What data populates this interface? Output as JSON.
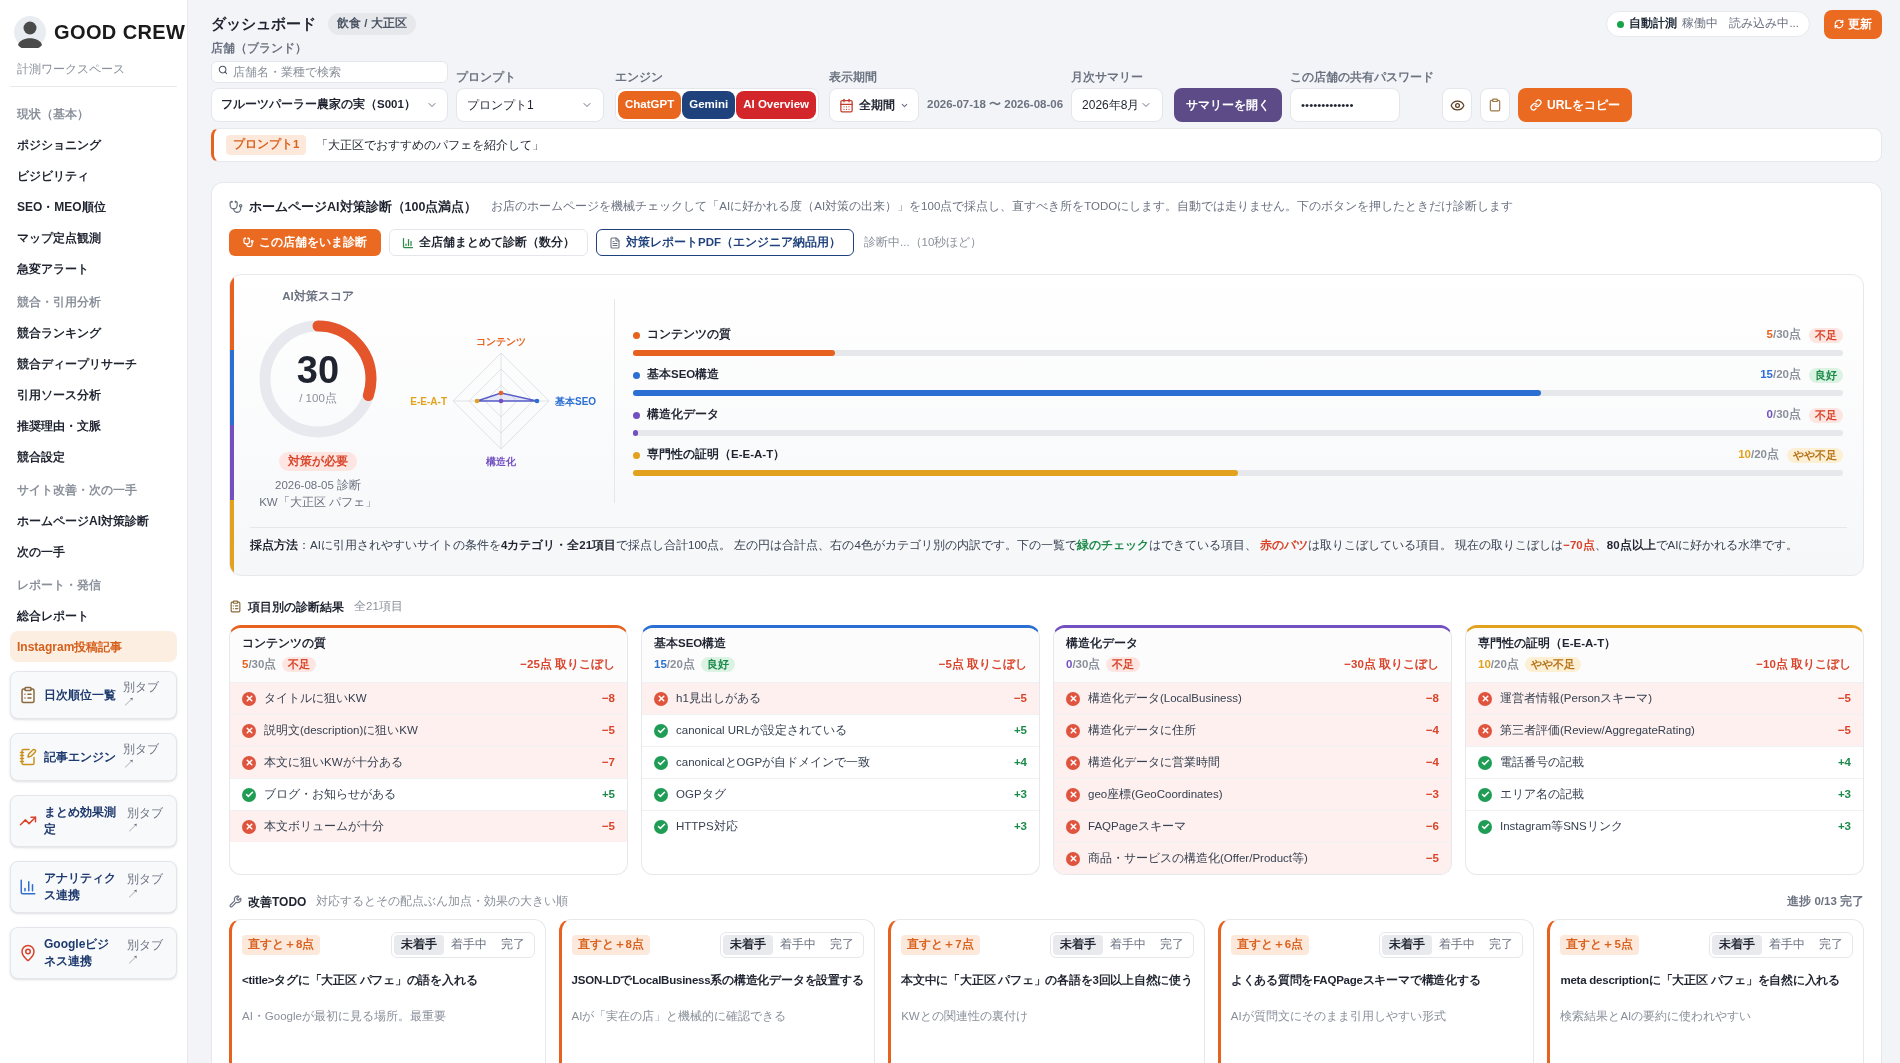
{
  "sidebar": {
    "brand": "GOOD CREW",
    "workspace": "計測ワークスペース",
    "sections": [
      {
        "title": "現状（基本）",
        "items": [
          {
            "label": "ポジショニング",
            "selected": false
          },
          {
            "label": "ビジビリティ",
            "selected": false
          },
          {
            "label": "SEO・MEO順位",
            "selected": false
          },
          {
            "label": "マップ定点観測",
            "selected": false
          },
          {
            "label": "急変アラート",
            "selected": false
          }
        ]
      },
      {
        "title": "競合・引用分析",
        "items": [
          {
            "label": "競合ランキング",
            "selected": false
          },
          {
            "label": "競合ディープリサーチ",
            "selected": false
          },
          {
            "label": "引用ソース分析",
            "selected": false
          },
          {
            "label": "推奨理由・文脈",
            "selected": false
          },
          {
            "label": "競合設定",
            "selected": false
          }
        ]
      },
      {
        "title": "サイト改善・次の一手",
        "items": [
          {
            "label": "ホームページAI対策診断",
            "selected": false
          },
          {
            "label": "次の一手",
            "selected": false
          }
        ]
      },
      {
        "title": "レポート・発信",
        "items": [
          {
            "label": "総合レポート",
            "selected": false
          },
          {
            "label": "Instagram投稿記事",
            "selected": true
          }
        ]
      }
    ],
    "links": [
      {
        "kind": "clipboard",
        "label": "日次順位一覧",
        "note": "別タブ ↗"
      },
      {
        "kind": "memo",
        "label": "記事エンジン",
        "note": "別タブ ↗"
      },
      {
        "kind": "trend",
        "label": "まとめ効果測定",
        "note": "別タブ ↗"
      },
      {
        "kind": "bars",
        "label": "アナリティクス連携",
        "note": "別タブ ↗"
      },
      {
        "kind": "pin",
        "label": "Googleビジネス連携",
        "note": "別タブ ↗"
      }
    ]
  },
  "header": {
    "title": "ダッシュボード",
    "badge": "飲食 / 大正区",
    "auto": {
      "label": "自動計測",
      "state": "稼働中",
      "loading": "読み込み中...",
      "running": true
    },
    "refresh": "更新"
  },
  "filters": {
    "store": {
      "label": "店舗（ブランド）",
      "search_placeholder": "店舗名・業種で検索",
      "value": "フルーツパーラー農家の実（S001）"
    },
    "prompt": {
      "label": "プロンプト",
      "value": "プロンプト1"
    },
    "engine": {
      "label": "エンジン",
      "options": [
        {
          "label": "ChatGPT",
          "color": "#e9661f",
          "selected": true
        },
        {
          "label": "Gemini",
          "color": "#1f417c",
          "selected": true
        },
        {
          "label": "AI Overview",
          "color": "#d2262b",
          "selected": true
        }
      ]
    },
    "period": {
      "label": "表示期間",
      "value": "全期間",
      "range": "2026-07-18 〜 2026-08-06"
    },
    "summary": {
      "label": "月次サマリー",
      "value": "2026年8月",
      "button": "サマリーを開く"
    },
    "password": {
      "label": "この店舗の共有パスワード",
      "value": "•••••••••••••"
    },
    "copy_button": "URLをコピー"
  },
  "prompt_bar": {
    "badge": "プロンプト1",
    "text": "「大正区でおすすめのパフェを紹介して」"
  },
  "diagnosis": {
    "title": "ホームページAI対策診断（100点満点）",
    "description": "お店のホームページを機械チェックして「AIに好かれる度（AI対策の出来）」を100点で採点し、直すべき所をTODOにします。自動では走りません。下のボタンを押したときだけ診断します",
    "actions": [
      {
        "kind": "primary",
        "label": "この店舗をいま診断"
      },
      {
        "kind": "secondary",
        "label": "全店舗まとめて診断（数分）"
      },
      {
        "kind": "outline",
        "label": "対策レポートPDF（エンジニア納品用）"
      }
    ],
    "status": "診断中...（10秒ほど）",
    "score": {
      "label": "AI対策スコア",
      "value": "30",
      "out_of": "/ 100点",
      "level": 0.3,
      "badge": "対策が必要",
      "kind": "bad",
      "date": "2026-08-05 診断",
      "keyword": "KW「大正区 パフェ」"
    },
    "categories": [
      {
        "name": "コンテンツの質",
        "radar_label": "コンテンツ",
        "color": "#e8621f",
        "score": "5",
        "out_of": "/30点",
        "badge": "不足",
        "kind": "bad",
        "level": 0.167
      },
      {
        "name": "基本SEO構造",
        "radar_label": "基本SEO",
        "color": "#2b6fd2",
        "score": "15",
        "out_of": "/20点",
        "badge": "良好",
        "kind": "good",
        "level": 0.75
      },
      {
        "name": "構造化データ",
        "radar_label": "構造化",
        "color": "#7250c0",
        "score": "0",
        "out_of": "/30点",
        "badge": "不足",
        "kind": "bad",
        "level": 0
      },
      {
        "name": "専門性の証明（E-E-A-T）",
        "radar_label": "E-E-A-T",
        "color": "#e3a21e",
        "score": "10",
        "out_of": "/20点",
        "badge": "やや不足",
        "kind": "fair",
        "level": 0.5
      }
    ],
    "note": [
      {
        "text": "採点方法",
        "kind": "bold"
      },
      {
        "text": "：AIに引用されやすいサイトの条件を",
        "kind": "plain"
      },
      {
        "text": "4カテゴリ・全21項目",
        "kind": "bold"
      },
      {
        "text": "で採点し合計100点。 左の円は合計点、右の4色がカテゴリ別の内訳です。下の一覧で",
        "kind": "plain"
      },
      {
        "text": "緑のチェック",
        "kind": "green"
      },
      {
        "text": "はできている項目、 ",
        "kind": "plain"
      },
      {
        "text": "赤のバツ",
        "kind": "red"
      },
      {
        "text": "は取りこぼしている項目。 現在の取りこぼしは",
        "kind": "plain"
      },
      {
        "text": "−70点",
        "kind": "red"
      },
      {
        "text": "、",
        "kind": "plain"
      },
      {
        "text": "80点以上",
        "kind": "bold"
      },
      {
        "text": "でAIに好かれる水準です。",
        "kind": "plain"
      }
    ]
  },
  "item_results": {
    "title": "項目別の診断結果",
    "count": "全21項目",
    "groups": [
      {
        "title": "コンテンツの質",
        "color": "#e8621f",
        "score": "5",
        "out_of": "/30点",
        "badge": "不足",
        "kind": "bad",
        "lost": "−25点 取りこぼし",
        "items": [
          {
            "label": "タイトルに狙いKW",
            "passed": false,
            "points": "−8"
          },
          {
            "label": "説明文(description)に狙いKW",
            "passed": false,
            "points": "−5"
          },
          {
            "label": "本文に狙いKWが十分ある",
            "passed": false,
            "points": "−7"
          },
          {
            "label": "ブログ・お知らせがある",
            "passed": true,
            "points": "+5"
          },
          {
            "label": "本文ボリュームが十分",
            "passed": false,
            "points": "−5"
          }
        ]
      },
      {
        "title": "基本SEO構造",
        "color": "#2b6fd2",
        "score": "15",
        "out_of": "/20点",
        "badge": "良好",
        "kind": "good",
        "lost": "−5点 取りこぼし",
        "items": [
          {
            "label": "h1見出しがある",
            "passed": false,
            "points": "−5"
          },
          {
            "label": "canonical URLが設定されている",
            "passed": true,
            "points": "+5"
          },
          {
            "label": "canonicalとOGPが自ドメインで一致",
            "passed": true,
            "points": "+4"
          },
          {
            "label": "OGPタグ",
            "passed": true,
            "points": "+3"
          },
          {
            "label": "HTTPS対応",
            "passed": true,
            "points": "+3"
          }
        ]
      },
      {
        "title": "構造化データ",
        "color": "#7250c0",
        "score": "0",
        "out_of": "/30点",
        "badge": "不足",
        "kind": "bad",
        "lost": "−30点 取りこぼし",
        "items": [
          {
            "label": "構造化データ(LocalBusiness)",
            "passed": false,
            "points": "−8"
          },
          {
            "label": "構造化データに住所",
            "passed": false,
            "points": "−4"
          },
          {
            "label": "構造化データに営業時間",
            "passed": false,
            "points": "−4"
          },
          {
            "label": "geo座標(GeoCoordinates)",
            "passed": false,
            "points": "−3"
          },
          {
            "label": "FAQPageスキーマ",
            "passed": false,
            "points": "−6"
          },
          {
            "label": "商品・サービスの構造化(Offer/Product等)",
            "passed": false,
            "points": "−5"
          }
        ]
      },
      {
        "title": "専門性の証明（E-E-A-T）",
        "color": "#e3a21e",
        "score": "10",
        "out_of": "/20点",
        "badge": "やや不足",
        "kind": "fair",
        "lost": "−10点 取りこぼし",
        "items": [
          {
            "label": "運営者情報(Personスキーマ)",
            "passed": false,
            "points": "−5"
          },
          {
            "label": "第三者評価(Review/AggregateRating)",
            "passed": false,
            "points": "−5"
          },
          {
            "label": "電話番号の記載",
            "passed": true,
            "points": "+4"
          },
          {
            "label": "エリア名の記載",
            "passed": true,
            "points": "+3"
          },
          {
            "label": "Instagram等SNSリンク",
            "passed": true,
            "points": "+3"
          }
        ]
      }
    ]
  },
  "todo": {
    "title": "改善TODO",
    "subtitle": "対応するとその配点ぶん加点・効果の大きい順",
    "progress": "進捗 0/13 完了",
    "items": [
      {
        "gain": "直すと＋8点",
        "title": "<title>タグに「大正区 パフェ」の語を入れる",
        "note": "AI・Googleが最初に見る場所。最重要",
        "statuses": [
          {
            "label": "未着手",
            "selected": true
          },
          {
            "label": "着手中",
            "selected": false
          },
          {
            "label": "完了",
            "selected": false
          }
        ]
      },
      {
        "gain": "直すと＋8点",
        "title": "JSON-LDでLocalBusiness系の構造化データを設置する",
        "note": "AIが「実在の店」と機械的に確認できる",
        "statuses": [
          {
            "label": "未着手",
            "selected": true
          },
          {
            "label": "着手中",
            "selected": false
          },
          {
            "label": "完了",
            "selected": false
          }
        ]
      },
      {
        "gain": "直すと＋7点",
        "title": "本文中に「大正区 パフェ」の各語を3回以上自然に使う",
        "note": "KWとの関連性の裏付け",
        "statuses": [
          {
            "label": "未着手",
            "selected": true
          },
          {
            "label": "着手中",
            "selected": false
          },
          {
            "label": "完了",
            "selected": false
          }
        ]
      },
      {
        "gain": "直すと＋6点",
        "title": "よくある質問をFAQPageスキーマで構造化する",
        "note": "AIが質問文にそのまま引用しやすい形式",
        "statuses": [
          {
            "label": "未着手",
            "selected": true
          },
          {
            "label": "着手中",
            "selected": false
          },
          {
            "label": "完了",
            "selected": false
          }
        ]
      },
      {
        "gain": "直すと＋5点",
        "title": "meta descriptionに「大正区 パフェ」を自然に入れる",
        "note": "検索結果とAIの要約に使われやすい",
        "statuses": [
          {
            "label": "未着手",
            "selected": true
          },
          {
            "label": "着手中",
            "selected": false
          },
          {
            "label": "完了",
            "selected": false
          }
        ]
      }
    ]
  }
}
